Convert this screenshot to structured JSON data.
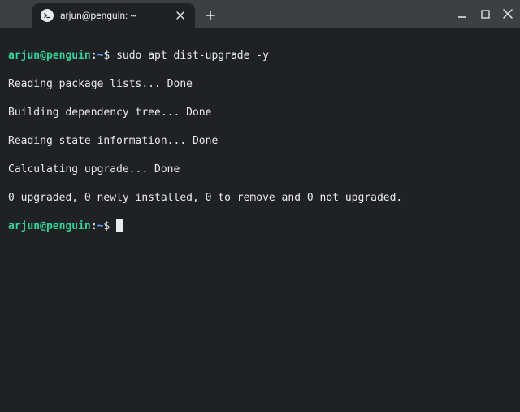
{
  "tab": {
    "title": "arjun@penguin: ~"
  },
  "prompt": {
    "userhost": "arjun@penguin",
    "path": "~",
    "symbol": "$"
  },
  "command1": "sudo apt dist-upgrade -y",
  "output": {
    "l1": "Reading package lists... Done",
    "l2": "Building dependency tree... Done",
    "l3": "Reading state information... Done",
    "l4": "Calculating upgrade... Done",
    "l5": "0 upgraded, 0 newly installed, 0 to remove and 0 not upgraded."
  }
}
